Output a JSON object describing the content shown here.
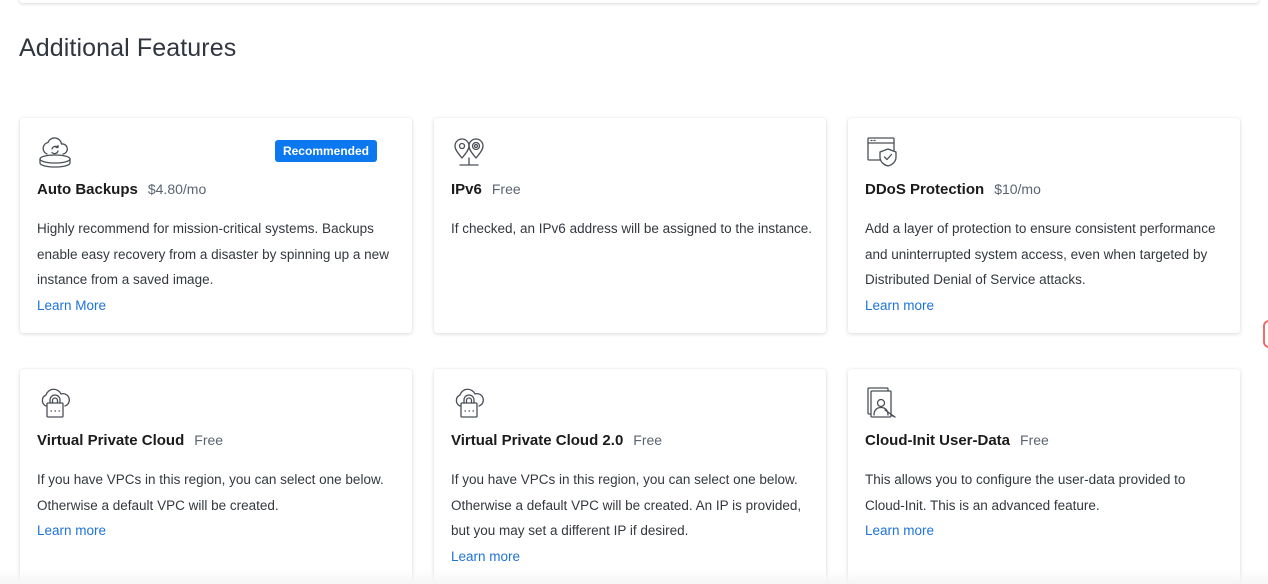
{
  "section": {
    "title": "Additional Features"
  },
  "cards": [
    {
      "title": "Auto Backups",
      "price": "$4.80/mo",
      "badge": "Recommended",
      "description": "Highly recommend for mission-critical systems. Backups enable easy recovery from a disaster by spinning up a new instance from a saved image.",
      "link": "Learn More",
      "icon": "backup-icon"
    },
    {
      "title": "IPv6",
      "price": "Free",
      "description": "If checked, an IPv6 address will be assigned to the instance.",
      "link": "",
      "icon": "ipv6-location-icon"
    },
    {
      "title": "DDoS Protection",
      "price": "$10/mo",
      "description": "Add a layer of protection to ensure consistent performance and uninterrupted system access, even when targeted by Distributed Denial of Service attacks.",
      "link": "Learn more",
      "icon": "shield-window-icon"
    },
    {
      "title": "Virtual Private Cloud",
      "price": "Free",
      "description": "If you have VPCs in this region, you can select one below. Otherwise a default VPC will be created.",
      "link": "Learn more",
      "icon": "cloud-lock-icon"
    },
    {
      "title": "Virtual Private Cloud 2.0",
      "price": "Free",
      "description": "If you have VPCs in this region, you can select one below. Otherwise a default VPC will be created. An IP is provided, but you may set a different IP if desired.",
      "link": "Learn more",
      "icon": "cloud-lock-icon"
    },
    {
      "title": "Cloud-Init User-Data",
      "price": "Free",
      "description": "This allows you to configure the user-data provided to Cloud-Init. This is an advanced feature.",
      "link": "Learn more",
      "icon": "user-document-icon"
    }
  ],
  "colors": {
    "accent": "#0b78f0",
    "link": "#1e73d8",
    "text": "#33383f",
    "icon_stroke": "#4a4f57"
  }
}
